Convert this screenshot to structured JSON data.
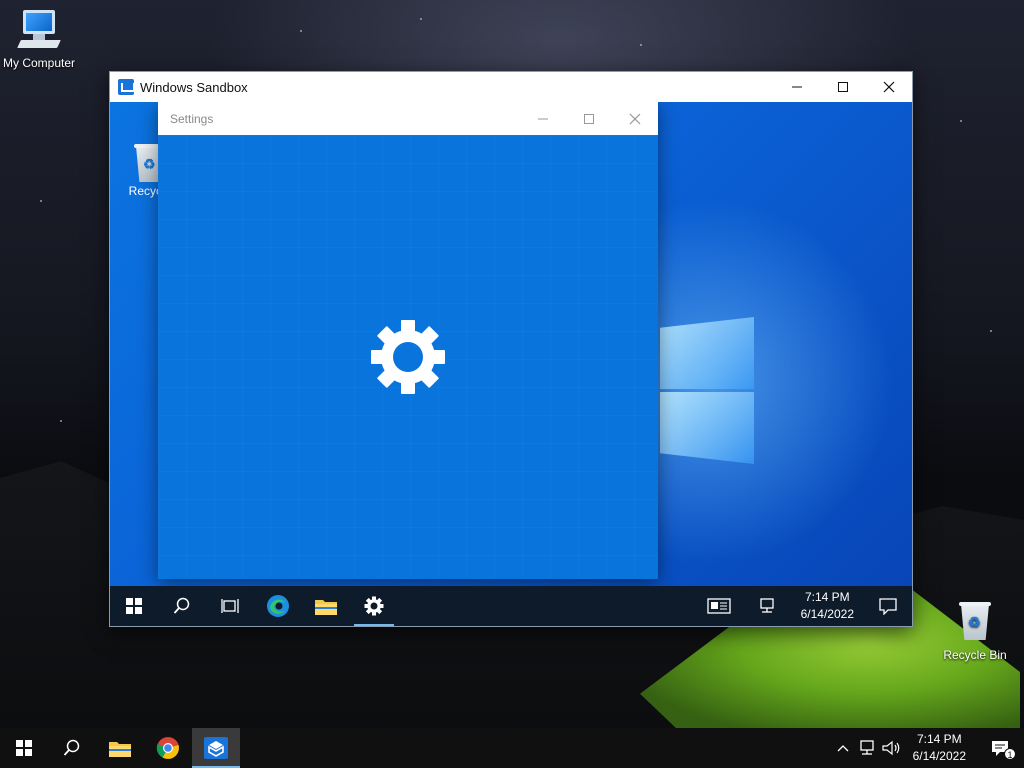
{
  "desktop": {
    "icons": [
      {
        "label": "My Computer"
      },
      {
        "label": "Recycle Bin"
      }
    ]
  },
  "sandbox_window": {
    "title": "Windows Sandbox",
    "desktop_icons": [
      {
        "label": "Recycle"
      }
    ],
    "settings_window": {
      "title": "Settings"
    },
    "taskbar": {
      "clock_time": "7:14 PM",
      "clock_date": "6/14/2022"
    }
  },
  "host_taskbar": {
    "clock_time": "7:14 PM",
    "clock_date": "6/14/2022",
    "notification_count": "1"
  },
  "colors": {
    "sandbox_accent": "#0a74dd",
    "taskbar_active_underline": "#76b9ed"
  }
}
